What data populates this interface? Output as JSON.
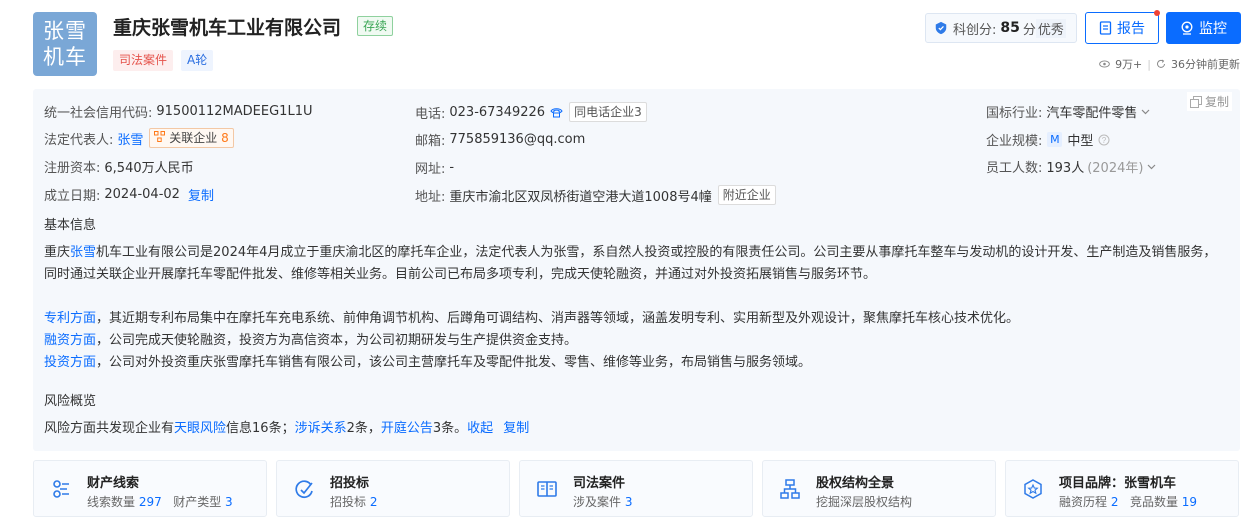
{
  "header": {
    "logo_line1": "张雪",
    "logo_line2": "机车",
    "company_name": "重庆张雪机车工业有限公司",
    "status": "存续",
    "tags": [
      "司法案件",
      "A轮"
    ],
    "score_label": "科创分:",
    "score_value": "85",
    "score_unit": "分",
    "score_grade": "优秀",
    "report_label": "报告",
    "monitor_label": "监控",
    "views": "9万+",
    "updated": "36分钟前更新"
  },
  "info": {
    "credit_code_label": "统一社会信用代码:",
    "credit_code": "91500112MADEEG1L1U",
    "legal_rep_label": "法定代表人:",
    "legal_rep": "张雪",
    "related_label": "关联企业",
    "related_count": "8",
    "capital_label": "注册资本:",
    "capital": "6,540万人民币",
    "founded_label": "成立日期:",
    "founded": "2024-04-02",
    "copy_label": "复制",
    "phone_label": "电话:",
    "phone": "023-67349226",
    "same_phone_label": "同电话企业",
    "same_phone_count": "3",
    "email_label": "邮箱:",
    "email": "775859136@qq.com",
    "website_label": "网址:",
    "website": "-",
    "address_label": "地址:",
    "address": "重庆市渝北区双凤桥街道空港大道1008号4幢",
    "nearby_label": "附近企业",
    "industry_label": "国标行业:",
    "industry": "汽车零配件零售",
    "scale_label": "企业规模:",
    "scale_badge": "M",
    "scale": "中型",
    "staff_label": "员工人数:",
    "staff": "193人",
    "staff_year": "(2024年)",
    "panel_copy": "复制"
  },
  "basic": {
    "title": "基本信息",
    "p1_a": "重庆",
    "p1_name": "张雪",
    "p1_b": "机车工业有限公司是2024年4月成立于重庆渝北区的摩托车企业，法定代表人为张雪，系自然人投资或控股的有限责任公司。公司主要从事摩托车整车与发动机的设计开发、生产制造及销售服务，同时通过关联企业开展摩托车零配件批发、维修等相关业务。目前公司已布局多项专利，完成天使轮融资，并通过对外投资拓展销售与服务环节。",
    "patent_label": "专利方面",
    "patent_text": "，其近期专利布局集中在摩托车充电系统、前伸角调节机构、后蹲角可调结构、消声器等领域，涵盖发明专利、实用新型及外观设计，聚焦摩托车核心技术优化。",
    "finance_label": "融资方面",
    "finance_text": "，公司完成天使轮融资，投资方为高信资本，为公司初期研发与生产提供资金支持。",
    "invest_label": "投资方面",
    "invest_text": "，公司对外投资重庆张雪摩托车销售有限公司，该公司主营摩托车及零配件批发、零售、维修等业务，布局销售与服务领域。"
  },
  "risk": {
    "title": "风险概览",
    "t1": "风险方面共发现企业有",
    "l1": "天眼风险",
    "t2": "信息16条；",
    "l2": "涉诉关系",
    "t3": "2条，",
    "l3": "开庭公告",
    "t4": "3条。",
    "collapse": "收起",
    "copy": "复制"
  },
  "cards": [
    {
      "title": "财产线索",
      "sub1": "线索数量",
      "n1": "297",
      "sub2": "财产类型",
      "n2": "3"
    },
    {
      "title": "招投标",
      "sub1": "招投标",
      "n1": "2",
      "sub2": "",
      "n2": ""
    },
    {
      "title": "司法案件",
      "sub1": "涉及案件",
      "n1": "3",
      "sub2": "",
      "n2": ""
    },
    {
      "title": "股权结构全景",
      "sub1": "挖掘深层股权结构",
      "n1": "",
      "sub2": "",
      "n2": ""
    },
    {
      "title": "项目品牌：张雪机车",
      "sub1": "融资历程",
      "n1": "2",
      "sub2": "竞品数量",
      "n2": "19"
    }
  ],
  "colors": {
    "accent": "#0a6cff",
    "logo_bg": "#7aa7d6",
    "status_green": "#3aa655",
    "tag_red": "#e5534b"
  }
}
